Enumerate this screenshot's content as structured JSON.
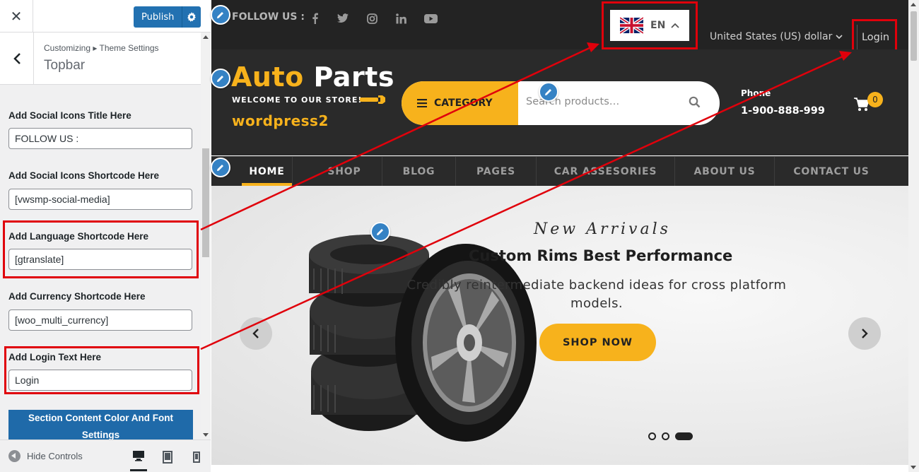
{
  "customizer": {
    "publish_label": "Publish",
    "breadcrumb": "Customizing ▸ Theme Settings",
    "section_title": "Topbar",
    "fields": [
      {
        "label": "Add Social Icons Title Here",
        "value": "FOLLOW US :"
      },
      {
        "label": "Add Social Icons Shortcode Here",
        "value": "[vwsmp-social-media]"
      },
      {
        "label": "Add Language Shortcode Here",
        "value": "[gtranslate]"
      },
      {
        "label": "Add Currency Shortcode Here",
        "value": "[woo_multi_currency]"
      },
      {
        "label": "Add Login Text Here",
        "value": "Login"
      }
    ],
    "section_button": "Section Content Color And Font Settings",
    "hide_controls": "Hide Controls",
    "devices": [
      "desktop-icon",
      "tablet-icon",
      "mobile-icon"
    ]
  },
  "preview": {
    "topbar": {
      "follow_label": "FOLLOW US :",
      "social_icons": [
        "facebook-icon",
        "twitter-icon",
        "instagram-icon",
        "linkedin-icon",
        "youtube-icon"
      ],
      "language_code": "EN",
      "currency": "United States (US) dollar",
      "login": "Login"
    },
    "header": {
      "logo_main": "Auto",
      "logo_accent": "Parts",
      "logo_tagline": "WELCOME TO OUR STORE!",
      "site_name": "wordpress2",
      "category_label": "CATEGORY",
      "search_placeholder": "Search products…",
      "phone_label": "Phone",
      "phone_number": "1-900-888-999",
      "cart_count": "0"
    },
    "nav": [
      "HOME",
      "SHOP",
      "BLOG",
      "PAGES",
      "CAR ASSESORIES",
      "ABOUT US",
      "CONTACT US"
    ],
    "slide": {
      "eyebrow": "New Arrivals",
      "title": "Custom Rims Best Performance",
      "description": "Credibly reintermediate backend ideas for cross platform models.",
      "button": "SHOP NOW"
    }
  },
  "colors": {
    "accent": "#f7b21c",
    "wp_blue": "#2271b1",
    "highlight_red": "#e0000b",
    "dark_bg": "#232323"
  }
}
